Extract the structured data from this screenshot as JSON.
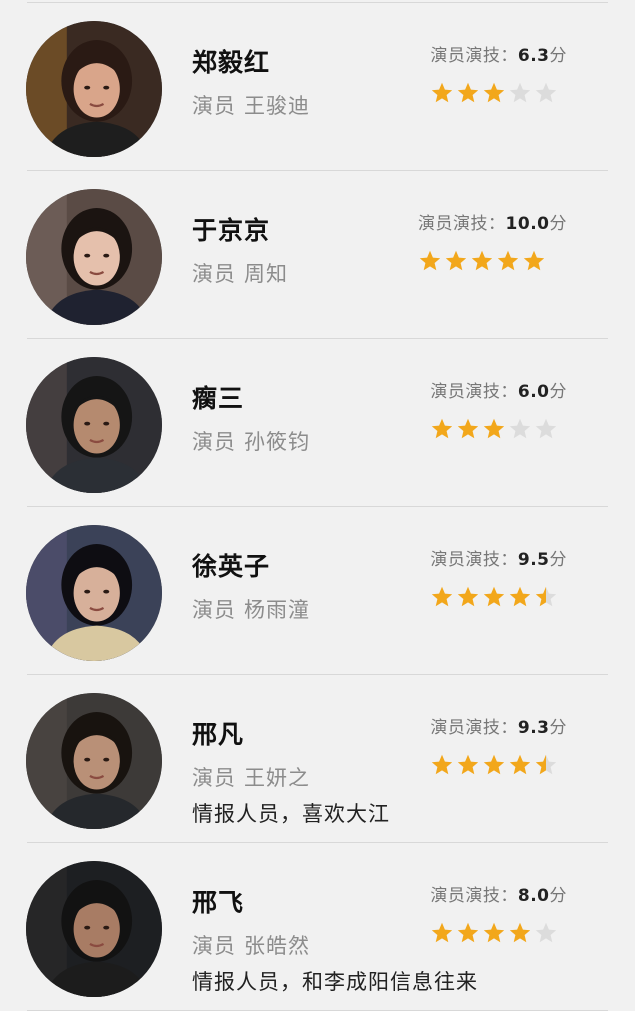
{
  "rating_label": "演员演技：",
  "score_unit": "分",
  "actor_prefix": "演员",
  "colors": {
    "star_filled": "#f2a71b",
    "star_empty": "#dcdcdc",
    "divider": "#d8d8d8",
    "background": "#f1f1f1"
  },
  "characters": [
    {
      "name": "郑毅红",
      "actor": "王骏迪",
      "score": "6.3",
      "stars": 3,
      "description": "",
      "avatar": "portrait-woman-drinking"
    },
    {
      "name": "于京京",
      "actor": "周知",
      "score": "10.0",
      "stars": 5,
      "description": "",
      "avatar": "portrait-woman-smiling"
    },
    {
      "name": "瘸三",
      "actor": "孙筱钧",
      "score": "6.0",
      "stars": 3,
      "description": "",
      "avatar": "portrait-man-dark"
    },
    {
      "name": "徐英子",
      "actor": "杨雨潼",
      "score": "9.5",
      "stars": 4.5,
      "description": "",
      "avatar": "portrait-woman-bob"
    },
    {
      "name": "邢凡",
      "actor": "王妍之",
      "score": "9.3",
      "stars": 4.5,
      "description": "情报人员，喜欢大江",
      "avatar": "portrait-woman-bun"
    },
    {
      "name": "邢飞",
      "actor": "张皓然",
      "score": "8.0",
      "stars": 4,
      "description": "情报人员，和李成阳信息往来",
      "avatar": "portrait-man-closeup"
    }
  ]
}
